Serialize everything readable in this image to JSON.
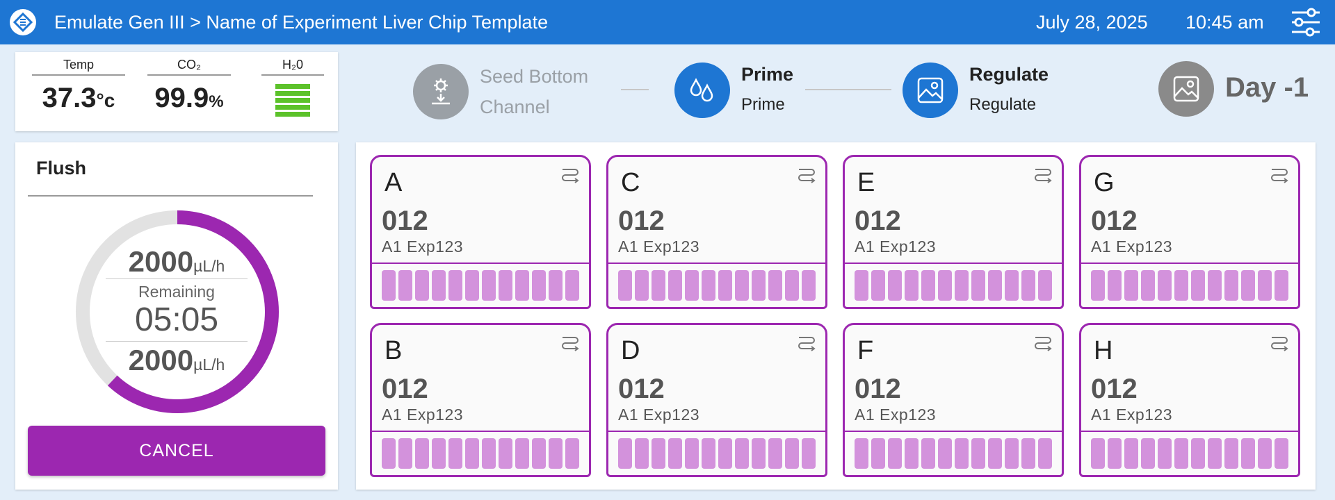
{
  "header": {
    "breadcrumb": "Emulate Gen III > Name of Experiment Liver Chip Template",
    "date": "July 28, 2025",
    "time": "10:45 am"
  },
  "environment": {
    "temp": {
      "label": "Temp",
      "value": "37.3",
      "unit": "°c"
    },
    "co2": {
      "label": "CO₂",
      "value": "99.9",
      "unit": "%"
    },
    "h2o": {
      "label": "H₂0",
      "level_fraction": 1.0
    }
  },
  "flush": {
    "title": "Flush",
    "rate_top": "2000",
    "rate_unit": "µL/h",
    "remaining_label": "Remaining",
    "remaining_time": "05:05",
    "rate_bottom": "2000",
    "progress_fraction": 0.62,
    "cancel_label": "CANCEL"
  },
  "steps": [
    {
      "line1": "Seed Bottom",
      "line2": "Channel",
      "state": "disabled"
    },
    {
      "title": "Prime",
      "subtitle": "Prime",
      "state": "active"
    },
    {
      "title": "Regulate",
      "subtitle": "Regulate",
      "state": "active"
    }
  ],
  "day_label": "Day -1",
  "chips": [
    {
      "letter": "A",
      "number": "012",
      "experiment": "A1 Exp123"
    },
    {
      "letter": "C",
      "number": "012",
      "experiment": "A1 Exp123"
    },
    {
      "letter": "E",
      "number": "012",
      "experiment": "A1 Exp123"
    },
    {
      "letter": "G",
      "number": "012",
      "experiment": "A1 Exp123"
    },
    {
      "letter": "B",
      "number": "012",
      "experiment": "A1 Exp123"
    },
    {
      "letter": "D",
      "number": "012",
      "experiment": "A1 Exp123"
    },
    {
      "letter": "F",
      "number": "012",
      "experiment": "A1 Exp123"
    },
    {
      "letter": "H",
      "number": "012",
      "experiment": "A1 Exp123"
    }
  ],
  "colors": {
    "header": "#1e76d3",
    "accent": "#9c27b0",
    "chip_bar": "#d392dc",
    "level_ok": "#5cc22a",
    "step_active": "#1e76d3",
    "step_disabled": "#9aa0a6"
  }
}
